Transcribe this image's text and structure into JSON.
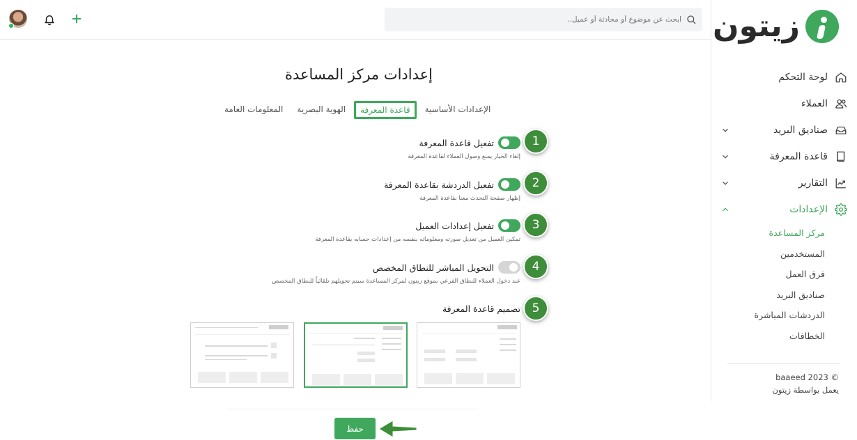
{
  "brand": {
    "logo_text": "زيتون",
    "accent": "#3fa85c",
    "badge_color": "#3e8d3a"
  },
  "topbar": {
    "search_placeholder": "ابحث عن موضوع أو محادثة أو عميل..",
    "icons": [
      "search-icon",
      "bell-icon",
      "plus-icon",
      "avatar"
    ]
  },
  "sidebar": {
    "items": [
      {
        "label": "لوحة التحكم",
        "icon": "home-icon"
      },
      {
        "label": "العملاء",
        "icon": "users-icon"
      },
      {
        "label": "صناديق البريد",
        "icon": "inbox-icon",
        "expandable": true
      },
      {
        "label": "قاعدة المعرفة",
        "icon": "book-icon",
        "expandable": true
      },
      {
        "label": "التقارير",
        "icon": "chart-icon",
        "expandable": true
      },
      {
        "label": "الإعدادات",
        "icon": "gear-icon",
        "expandable": true,
        "expanded": true,
        "active": true
      }
    ],
    "sub_items": [
      {
        "label": "مركز المساعدة",
        "active": true
      },
      {
        "label": "المستخدمين"
      },
      {
        "label": "فرق العمل"
      },
      {
        "label": "صناديق البريد"
      },
      {
        "label": "الدردشات المباشرة"
      },
      {
        "label": "الخطافات"
      }
    ],
    "footer": {
      "copyright": "© baaeed 2023",
      "powered_by": "يعمل بواسطة زيتون"
    }
  },
  "main": {
    "title": "إعدادات مركز المساعدة",
    "tabs": [
      {
        "label": "الإعدادات الأساسية"
      },
      {
        "label": "قاعدة المعرفة",
        "active": true
      },
      {
        "label": "الهوية البصرية"
      },
      {
        "label": "المعلومات العامة"
      }
    ],
    "settings": [
      {
        "label": "تفعيل قاعدة المعرفة",
        "desc": "إلغاء الخيار يمنع وصول العملاء لقاعدة المعرفة",
        "on": true,
        "badge": "1"
      },
      {
        "label": "تفعيل الدردشة بقاعدة المعرفة",
        "desc": "إظهار صفحة التحدث معنا بقاعدة المعرفة",
        "on": true,
        "badge": "2"
      },
      {
        "label": "تفعيل إعدادات العميل",
        "desc": "تمكين العميل من تعديل صورته ومعلوماته بنفسه من إعدادات حسابه بقاعدة المعرفة",
        "on": true,
        "badge": "3"
      },
      {
        "label": "التحويل المباشر للنطاق المخصص",
        "desc": "عند دخول العملاء للنطاق الفرعي بموقع زيتون لمركز المساعدة سيتم تحويلهم تلقائياً للنطاق المخصص",
        "on": false,
        "badge": "4"
      }
    ],
    "design_section": {
      "label": "تصميم قاعدة المعرفة",
      "badge": "5",
      "options_count_selected": 2
    },
    "save_label": "حفظ"
  }
}
